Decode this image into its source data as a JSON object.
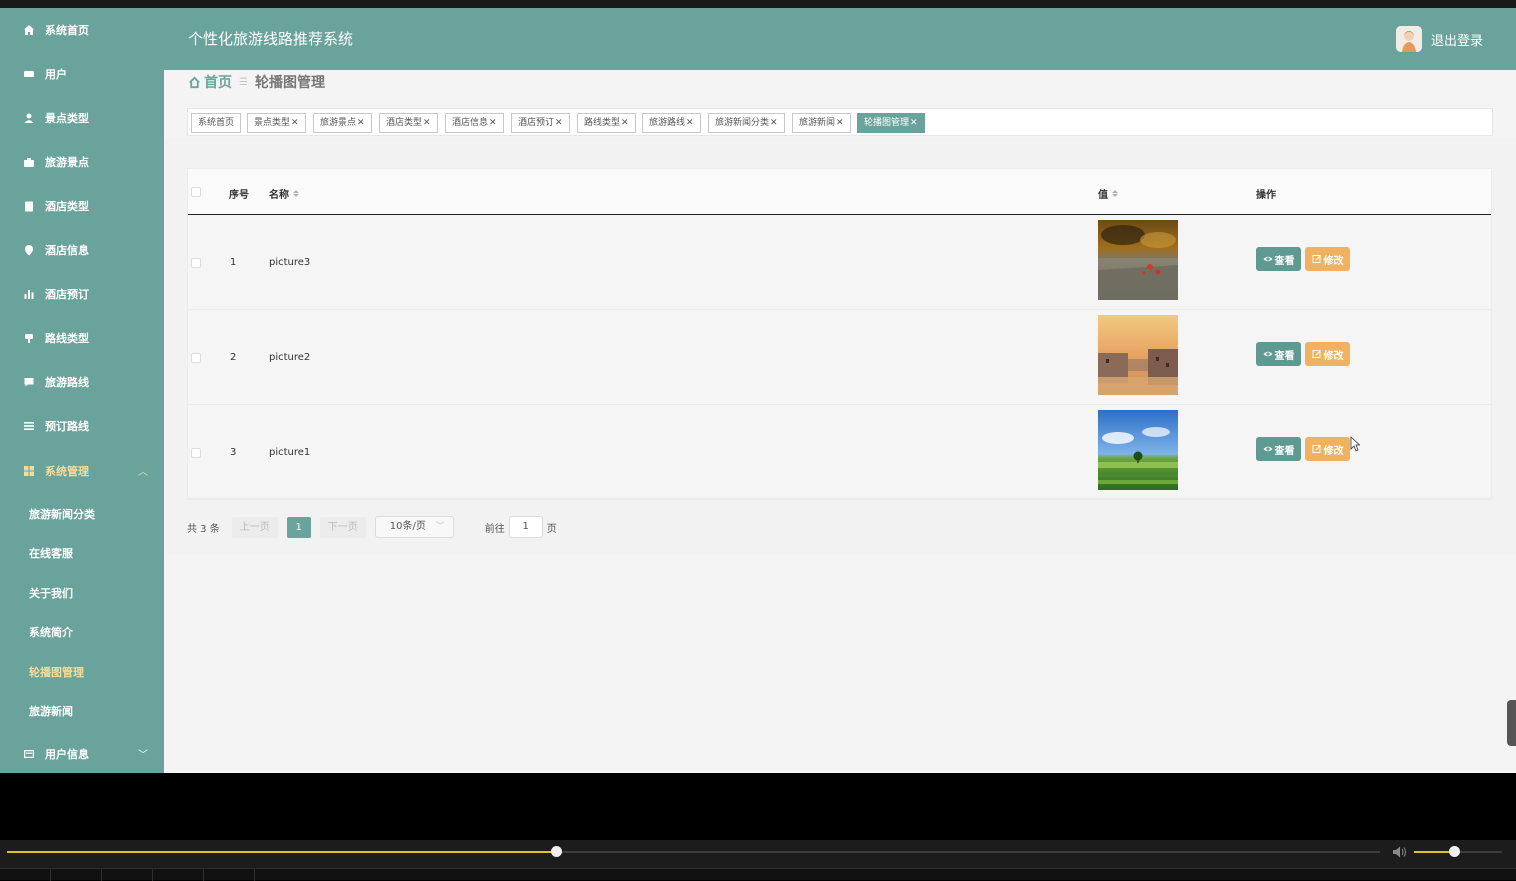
{
  "app": {
    "title": "个性化旅游线路推荐系统",
    "logout": "退出登录"
  },
  "colors": {
    "primary": "#6aa39b",
    "active_menu": "#f3dd9c",
    "edit_button": "#f0b160",
    "view_button": "#5f9a92"
  },
  "sidebar": {
    "items": [
      {
        "label": "系统首页",
        "icon": "home-icon"
      },
      {
        "label": "用户",
        "icon": "id-card-icon"
      },
      {
        "label": "景点类型",
        "icon": "user-icon"
      },
      {
        "label": "旅游景点",
        "icon": "briefcase-icon"
      },
      {
        "label": "酒店类型",
        "icon": "clipboard-icon"
      },
      {
        "label": "酒店信息",
        "icon": "location-pin-icon"
      },
      {
        "label": "酒店预订",
        "icon": "bar-chart-icon"
      },
      {
        "label": "路线类型",
        "icon": "pin-icon"
      },
      {
        "label": "旅游路线",
        "icon": "chat-icon"
      },
      {
        "label": "预订路线",
        "icon": "list-icon"
      },
      {
        "label": "系统管理",
        "icon": "grid-icon",
        "expanded": true
      },
      {
        "label": "用户信息",
        "icon": "id-box-icon",
        "expanded": false
      }
    ],
    "system_sub": [
      "旅游新闻分类",
      "在线客服",
      "关于我们",
      "系统简介",
      "轮播图管理",
      "旅游新闻"
    ],
    "active_sub": "轮播图管理"
  },
  "breadcrumb": {
    "home": "首页",
    "current": "轮播图管理"
  },
  "tags": [
    "系统首页",
    "景点类型",
    "旅游景点",
    "酒店类型",
    "酒店信息",
    "酒店预订",
    "路线类型",
    "旅游路线",
    "旅游新闻分类",
    "旅游新闻",
    "轮播图管理"
  ],
  "table": {
    "headers": {
      "index": "序号",
      "name": "名称",
      "value": "值",
      "actions": "操作"
    },
    "rows": [
      {
        "index": "1",
        "name": "picture3",
        "image": "poppy-field"
      },
      {
        "index": "2",
        "name": "picture2",
        "image": "venice-sunset"
      },
      {
        "index": "3",
        "name": "picture1",
        "image": "green-field-tree"
      }
    ],
    "view_label": "查看",
    "edit_label": "修改"
  },
  "pagination": {
    "total": "共 3 条",
    "prev": "上一页",
    "page": "1",
    "next": "下一页",
    "page_size": "10条/页",
    "goto_label": "前往",
    "goto_value": "1",
    "page_unit": "页"
  },
  "player": {
    "progress": 0.4,
    "volume": 0.45
  }
}
